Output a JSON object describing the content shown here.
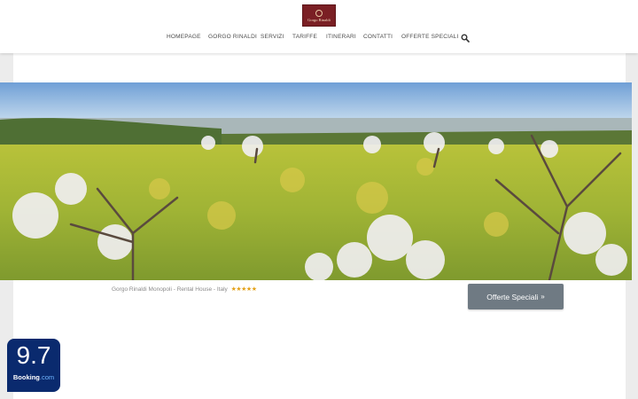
{
  "logo": {
    "text": "Gorgo Rinaldi",
    "brand_color": "#7a1f24"
  },
  "nav": {
    "items": [
      {
        "label": "HOMEPAGE"
      },
      {
        "label": "GORGO RINALDI"
      },
      {
        "label": "SERVIZI"
      },
      {
        "label": "TARIFFE"
      },
      {
        "label": "ITINERARI"
      },
      {
        "label": "CONTATTI"
      },
      {
        "label": "OFFERTE SPECIALI"
      }
    ],
    "search_icon": "search-icon"
  },
  "banner": {
    "description_icon": "landscape-photo"
  },
  "caption": {
    "text": "Gorgo Rinaldi Monopoli - Rental House - Italy",
    "stars": "★★★★★",
    "star_rating": 5
  },
  "cta": {
    "label": "Offerte Speciali",
    "chevron": "»",
    "color": "#6f7a83"
  },
  "booking": {
    "score": "9.7",
    "brand": "Booking",
    "suffix": ".com",
    "color": "#0a2a6e"
  }
}
